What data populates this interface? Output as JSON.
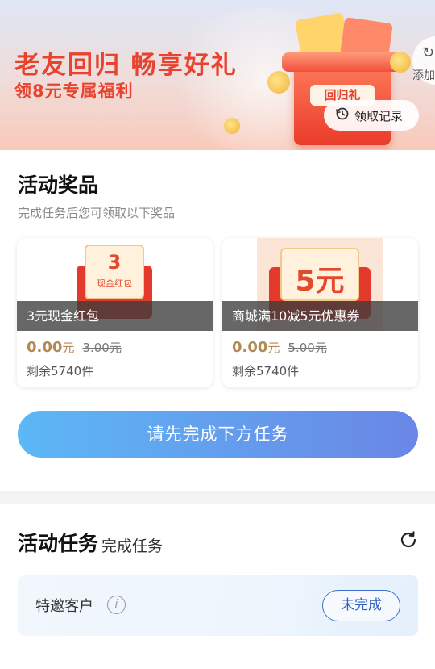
{
  "banner": {
    "headline": "老友回归 畅享好礼",
    "subline": "领8元专属福利",
    "gift_label": "回归礼",
    "add_label": "添加",
    "record_label": "领取记录"
  },
  "prizes": {
    "title": "活动奖品",
    "subtitle": "完成任务后您可领取以下奖品",
    "items": [
      {
        "art_number": "3",
        "art_label": "现金红包",
        "name": "3元现金红包",
        "price": "0.00",
        "unit": "元",
        "original_price": "3.00元",
        "stock": "剩余5740件"
      },
      {
        "art_number": "5元",
        "name": "商城满10减5元优惠券",
        "price": "0.00",
        "unit": "元",
        "original_price": "5.00元",
        "stock": "剩余5740件"
      }
    ],
    "cta_label": "请先完成下方任务"
  },
  "tasks": {
    "title": "活动任务",
    "subtitle": "完成任务",
    "items": [
      {
        "name": "特邀客户",
        "status": "未完成"
      }
    ]
  },
  "colors": {
    "brand_red": "#e8432e",
    "cta_start": "#5cb8f6",
    "cta_end": "#6a86e6",
    "price_gold": "#b38a54",
    "status_blue": "#2f5fc4"
  },
  "icons": [
    "history-icon",
    "refresh-icon",
    "info-icon",
    "add-icon"
  ]
}
